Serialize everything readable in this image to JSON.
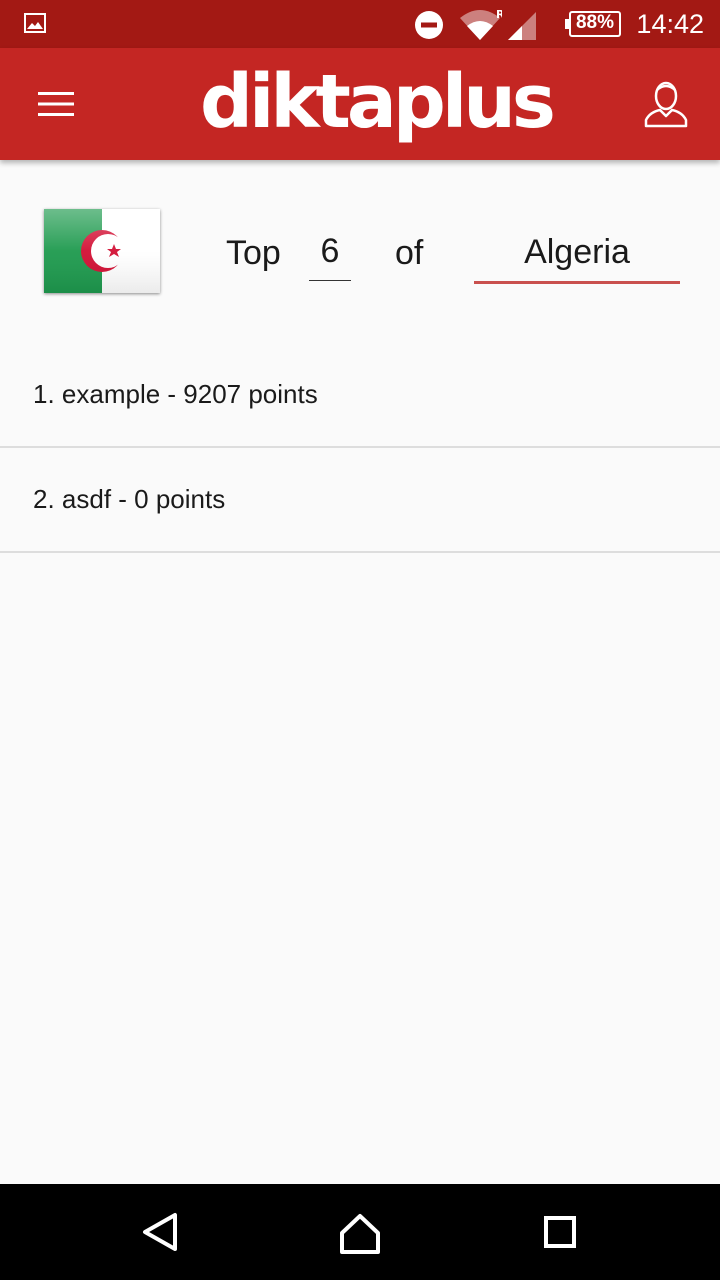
{
  "status_bar": {
    "battery": "88%",
    "time": "14:42",
    "network_badge": "R",
    "icons": [
      "gallery-notification-icon",
      "do-not-disturb-icon",
      "wifi-icon",
      "cell-signal-icon",
      "battery-icon"
    ]
  },
  "app_bar": {
    "logo": "diktaplus",
    "icons": [
      "menu-icon",
      "profile-icon"
    ]
  },
  "ranking": {
    "top_label": "Top",
    "count": "6",
    "of_label": "of",
    "country": "Algeria",
    "flag": "flag-algeria-icon"
  },
  "list": {
    "items": [
      {
        "label": "1. example - 9207 points"
      },
      {
        "label": "2. asdf - 0 points"
      }
    ]
  },
  "nav_bar": {
    "icons": [
      "back-icon",
      "home-icon",
      "recent-apps-icon"
    ]
  },
  "colors": {
    "status_bar": "#a31914",
    "app_bar": "#c42623",
    "accent_underline": "#c9504e",
    "background": "#fafafa",
    "nav_bar": "#000000"
  }
}
